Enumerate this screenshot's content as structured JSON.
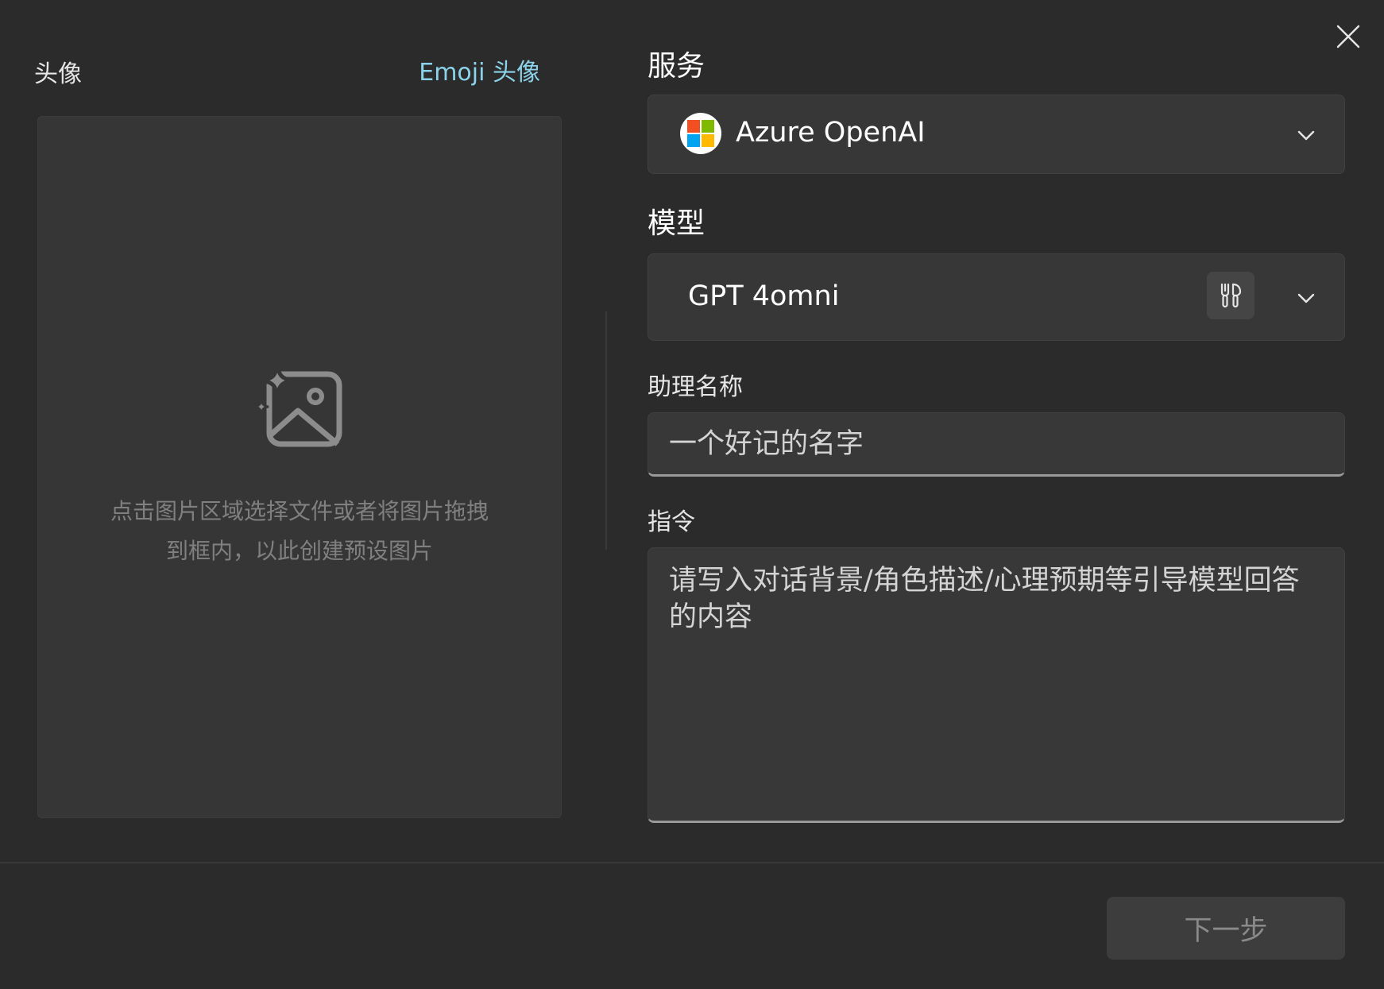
{
  "avatar": {
    "label": "头像",
    "emoji_link": "Emoji 头像",
    "dropzone_hint_line1": "点击图片区域选择文件或者将图片拖拽",
    "dropzone_hint_line2": "到框内，以此创建预设图片",
    "icon": "image-sparkle-icon"
  },
  "service": {
    "title": "服务",
    "selected": "Azure OpenAI",
    "icon": "microsoft-logo-icon"
  },
  "model": {
    "title": "模型",
    "selected": "GPT 4omni",
    "tool_icon": "tools-icon"
  },
  "assistant_name": {
    "label": "助理名称",
    "placeholder": "一个好记的名字"
  },
  "instruction": {
    "label": "指令",
    "placeholder": "请写入对话背景/角色描述/心理预期等引导模型回答的内容"
  },
  "footer": {
    "next_label": "下一步"
  },
  "colors": {
    "background": "#2b2b2b",
    "accent_link": "#8bd3ea",
    "ms_red": "#f25022",
    "ms_green": "#7fba00",
    "ms_blue": "#00a4ef",
    "ms_yellow": "#ffb900"
  }
}
